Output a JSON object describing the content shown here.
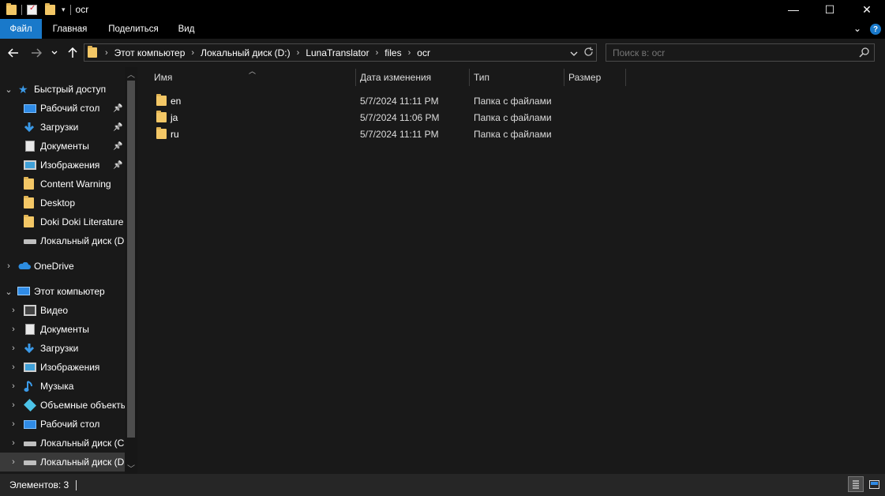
{
  "window": {
    "title": "ocr"
  },
  "window_controls": {
    "minimize": "—",
    "maximize": "☐",
    "close": "✕"
  },
  "ribbon": {
    "tabs": [
      "Файл",
      "Главная",
      "Поделиться",
      "Вид"
    ],
    "help": "?"
  },
  "address": {
    "breadcrumbs": [
      "Этот компьютер",
      "Локальный диск (D:)",
      "LunaTranslator",
      "files",
      "ocr"
    ]
  },
  "search": {
    "placeholder": "Поиск в: ocr"
  },
  "nav": {
    "quick_access": {
      "label": "Быстрый доступ",
      "items": [
        {
          "label": "Рабочий стол",
          "icon": "desktop-icon",
          "pinned": true
        },
        {
          "label": "Загрузки",
          "icon": "download-icon",
          "pinned": true
        },
        {
          "label": "Документы",
          "icon": "documents-icon",
          "pinned": true
        },
        {
          "label": "Изображения",
          "icon": "pictures-icon",
          "pinned": true
        },
        {
          "label": "Content Warning",
          "icon": "folder-icon",
          "pinned": false
        },
        {
          "label": "Desktop",
          "icon": "folder-icon",
          "pinned": false
        },
        {
          "label": "Doki Doki Literature",
          "icon": "folder-icon",
          "pinned": false
        },
        {
          "label": "Локальный диск (D",
          "icon": "drive-icon",
          "pinned": false
        }
      ]
    },
    "onedrive": {
      "label": "OneDrive"
    },
    "this_pc": {
      "label": "Этот компьютер",
      "items": [
        {
          "label": "Видео",
          "icon": "video-icon"
        },
        {
          "label": "Документы",
          "icon": "documents-icon"
        },
        {
          "label": "Загрузки",
          "icon": "download-icon"
        },
        {
          "label": "Изображения",
          "icon": "pictures-icon"
        },
        {
          "label": "Музыка",
          "icon": "music-icon"
        },
        {
          "label": "Объемные объекть",
          "icon": "3d-objects-icon"
        },
        {
          "label": "Рабочий стол",
          "icon": "desktop-icon"
        },
        {
          "label": "Локальный диск (С",
          "icon": "drive-icon"
        },
        {
          "label": "Локальный диск (D",
          "icon": "drive-icon",
          "selected": true
        }
      ]
    }
  },
  "columns": [
    "Имя",
    "Дата изменения",
    "Тип",
    "Размер"
  ],
  "files": [
    {
      "name": "en",
      "date": "5/7/2024 11:11 PM",
      "type": "Папка с файлами",
      "size": ""
    },
    {
      "name": "ja",
      "date": "5/7/2024 11:06 PM",
      "type": "Папка с файлами",
      "size": ""
    },
    {
      "name": "ru",
      "date": "5/7/2024 11:11 PM",
      "type": "Папка с файлами",
      "size": ""
    }
  ],
  "status": {
    "text": "Элементов: 3"
  },
  "colors": {
    "accent": "#1979ca",
    "background": "#191919",
    "folder": "#f3c766"
  }
}
